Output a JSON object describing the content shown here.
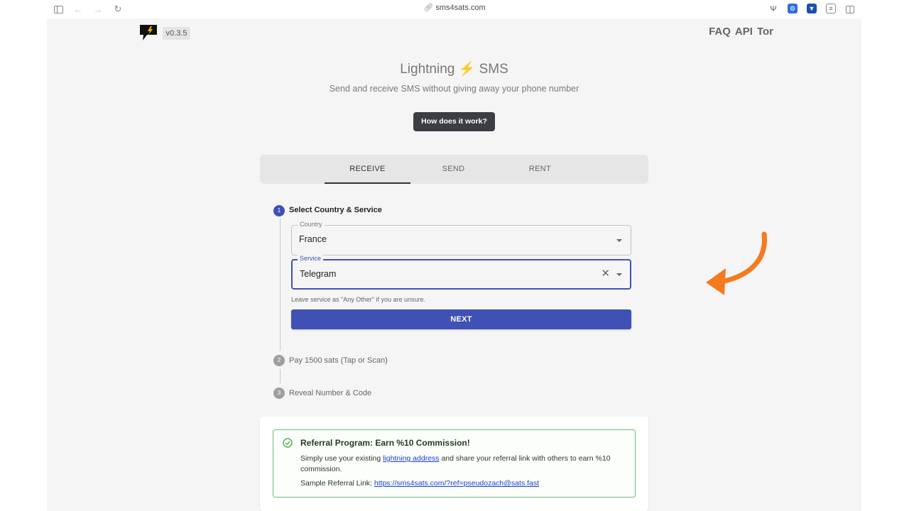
{
  "browser": {
    "url": "sms4sats.com"
  },
  "header": {
    "version": "v0.3.5",
    "nav": [
      "FAQ",
      "API",
      "Tor"
    ]
  },
  "hero": {
    "title_left": "Lightning",
    "title_bolt": "⚡",
    "title_right": "SMS",
    "subtitle": "Send and receive SMS without giving away your phone number",
    "how_button": "How does it work?"
  },
  "tabs": [
    {
      "label": "RECEIVE",
      "active": true
    },
    {
      "label": "SEND",
      "active": false
    },
    {
      "label": "RENT",
      "active": false
    }
  ],
  "steps": [
    {
      "number": "1",
      "label": "Select Country & Service",
      "active": true
    },
    {
      "number": "2",
      "label": "Pay 1500 sats (Tap or Scan)",
      "active": false
    },
    {
      "number": "3",
      "label": "Reveal Number & Code",
      "active": false
    }
  ],
  "form": {
    "country_label": "Country",
    "country_value": "France",
    "service_label": "Service",
    "service_value": "Telegram",
    "helper": "Leave service as \"Any Other\" if you are unsure.",
    "next_button": "NEXT"
  },
  "referral": {
    "title": "Referral Program: Earn %10 Commission!",
    "text_before": "Simply use your existing ",
    "text_link": "lightning address",
    "text_after": " and share your referral link with others to earn %10 commission.",
    "sample_label": "Sample Referral Link: ",
    "sample_link": "https://sms4sats.com/?ref=pseudozach@sats.fast"
  },
  "colors": {
    "primary": "#3f51b5",
    "accent_arrow": "#f47a20",
    "success_border": "#6bbf6f",
    "bolt": "#f5b400"
  }
}
